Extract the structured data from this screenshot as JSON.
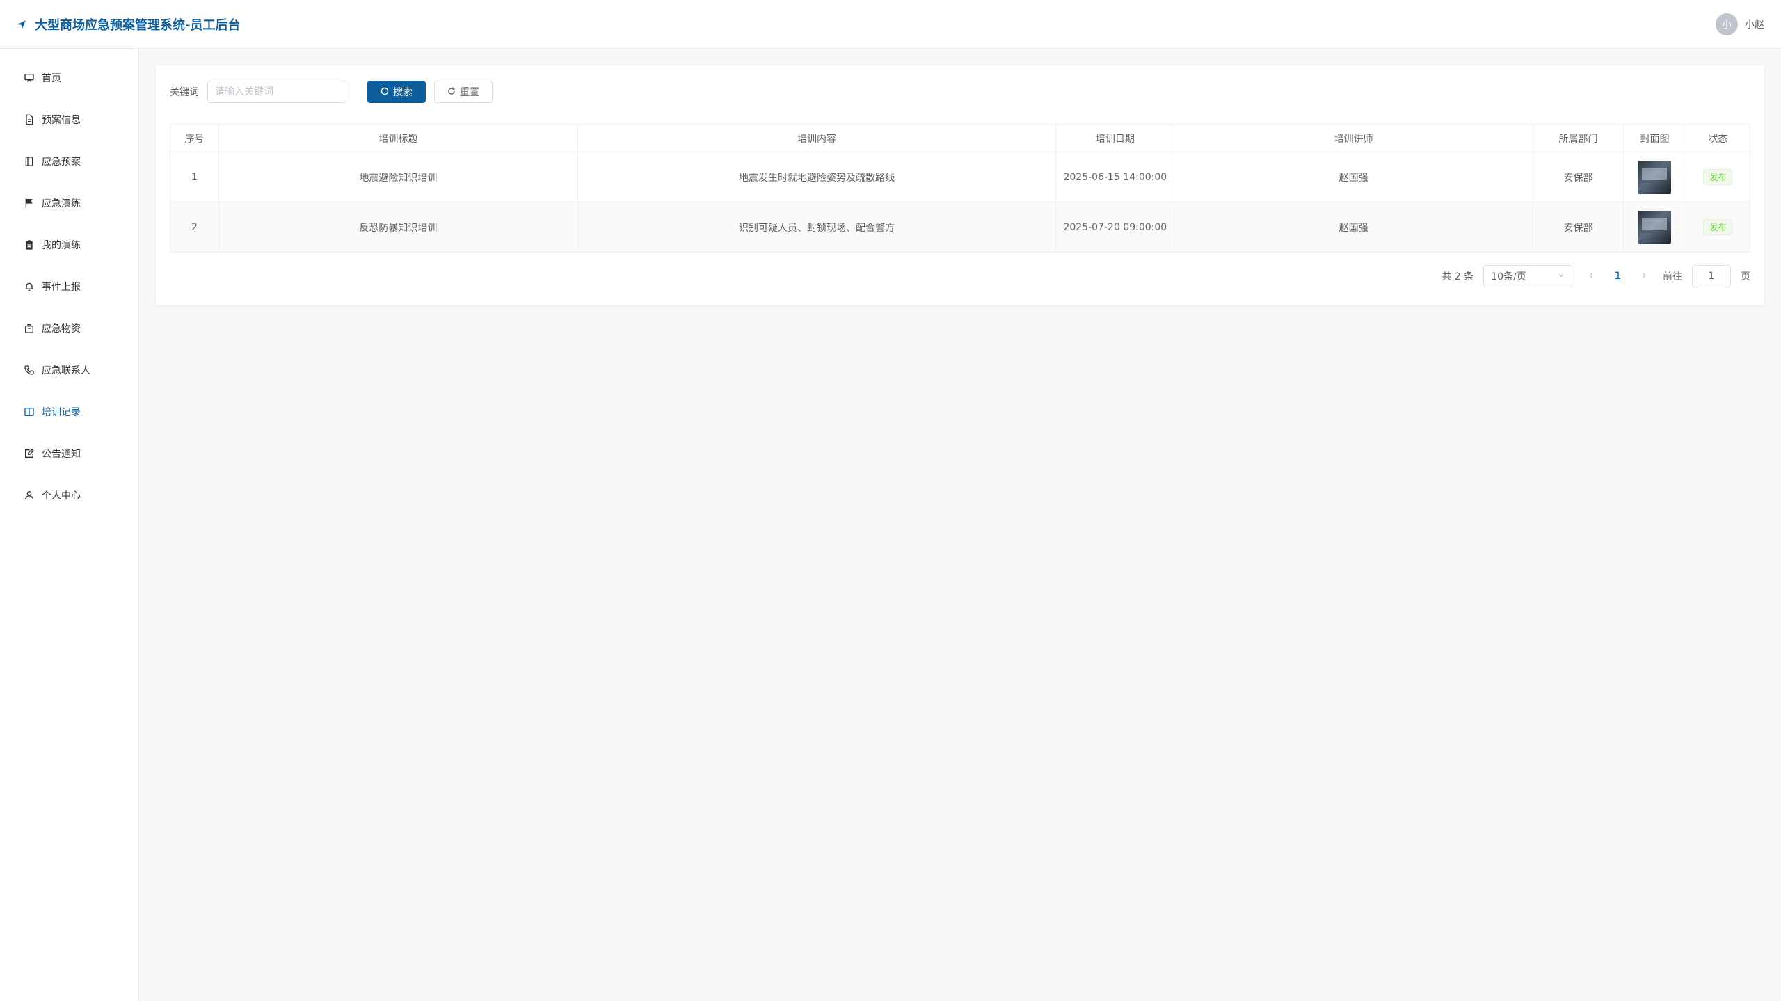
{
  "header": {
    "title": "大型商场应急预案管理系统-员工后台",
    "user_avatar_text": "小",
    "user_name": "小赵"
  },
  "sidebar": {
    "items": [
      {
        "label": "首页",
        "icon": "home-icon"
      },
      {
        "label": "预案信息",
        "icon": "document-icon"
      },
      {
        "label": "应急预案",
        "icon": "book-icon"
      },
      {
        "label": "应急演练",
        "icon": "flag-icon"
      },
      {
        "label": "我的演练",
        "icon": "clipboard-icon"
      },
      {
        "label": "事件上报",
        "icon": "bell-icon"
      },
      {
        "label": "应急物资",
        "icon": "box-icon"
      },
      {
        "label": "应急联系人",
        "icon": "phone-icon"
      },
      {
        "label": "培训记录",
        "icon": "open-book-icon",
        "active": true
      },
      {
        "label": "公告通知",
        "icon": "edit-icon"
      },
      {
        "label": "个人中心",
        "icon": "user-icon"
      }
    ]
  },
  "search": {
    "label": "关键词",
    "placeholder": "请输入关键词",
    "search_button": "搜索",
    "reset_button": "重置"
  },
  "table": {
    "columns": [
      "序号",
      "培训标题",
      "培训内容",
      "培训日期",
      "培训讲师",
      "所属部门",
      "封面图",
      "状态"
    ],
    "rows": [
      {
        "index": "1",
        "title": "地震避险知识培训",
        "content": "地震发生时就地避险姿势及疏散路线",
        "date": "2025-06-15 14:00:00",
        "instructor": "赵国强",
        "department": "安保部",
        "status": "发布"
      },
      {
        "index": "2",
        "title": "反恐防暴知识培训",
        "content": "识别可疑人员、封锁现场、配合警方",
        "date": "2025-07-20 09:00:00",
        "instructor": "赵国强",
        "department": "安保部",
        "status": "发布"
      }
    ]
  },
  "pagination": {
    "total_text": "共 2 条",
    "page_size": "10条/页",
    "current_page": "1",
    "goto_label": "前往",
    "goto_value": "1",
    "page_suffix": "页"
  },
  "colors": {
    "accent": "#0e5e9b",
    "status_green": "#67c23a"
  }
}
